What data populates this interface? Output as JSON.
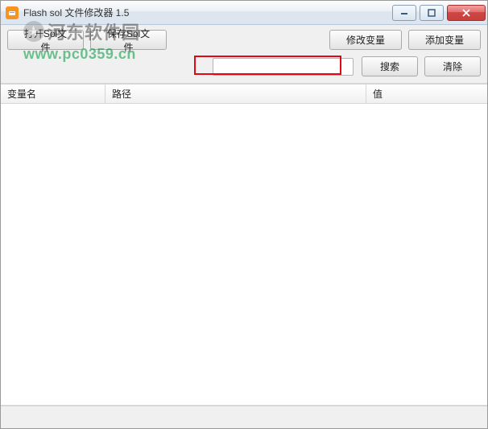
{
  "window": {
    "title": "Flash sol 文件修改器 1.5"
  },
  "toolbar": {
    "open_label": "打开Sol文件",
    "save_label": "保存Sol文件",
    "modify_label": "修改变量",
    "add_label": "添加变量",
    "search_label": "搜索",
    "clear_label": "清除",
    "search_value": ""
  },
  "table": {
    "columns": {
      "name": "变量名",
      "path": "路径",
      "value": "值"
    },
    "rows": []
  },
  "watermark": {
    "text": "河东软件园",
    "url": "www.pc0359.cn"
  }
}
